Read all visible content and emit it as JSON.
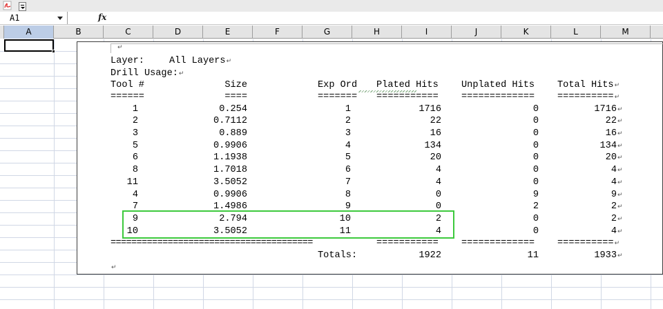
{
  "toolbar": {
    "pdf_icon": "pdf-icon",
    "dropdown_icon": "toolbar-dropdown-icon"
  },
  "formula_bar": {
    "name_box": "A1",
    "fx_label": "fx",
    "content": ""
  },
  "columns": [
    "A",
    "B",
    "C",
    "D",
    "E",
    "F",
    "G",
    "H",
    "I",
    "J",
    "K",
    "L",
    "M"
  ],
  "selected_column": "A",
  "report": {
    "layer_label": "Layer:",
    "layer_value": "All Layers",
    "drill_usage": "Drill Usage:",
    "headers": {
      "tool": "Tool #",
      "size": "Size",
      "exp_ord": "Exp Ord",
      "plated": "Plated Hits",
      "unplated": "Unplated Hits",
      "total": "Total Hits"
    },
    "header_rules": {
      "tool": "======",
      "size": "====",
      "exp_ord": "=======",
      "plated": "===========",
      "unplated": "=============",
      "total": "=========="
    },
    "rows": [
      {
        "tool": "1",
        "size": "0.254",
        "exp_ord": "1",
        "plated": "1716",
        "unplated": "0",
        "total": "1716"
      },
      {
        "tool": "2",
        "size": "0.7112",
        "exp_ord": "2",
        "plated": "22",
        "unplated": "0",
        "total": "22"
      },
      {
        "tool": "3",
        "size": "0.889",
        "exp_ord": "3",
        "plated": "16",
        "unplated": "0",
        "total": "16"
      },
      {
        "tool": "5",
        "size": "0.9906",
        "exp_ord": "4",
        "plated": "134",
        "unplated": "0",
        "total": "134"
      },
      {
        "tool": "6",
        "size": "1.1938",
        "exp_ord": "5",
        "plated": "20",
        "unplated": "0",
        "total": "20"
      },
      {
        "tool": "8",
        "size": "1.7018",
        "exp_ord": "6",
        "plated": "4",
        "unplated": "0",
        "total": "4"
      },
      {
        "tool": "11",
        "size": "3.5052",
        "exp_ord": "7",
        "plated": "4",
        "unplated": "0",
        "total": "4"
      },
      {
        "tool": "4",
        "size": "0.9906",
        "exp_ord": "8",
        "plated": "0",
        "unplated": "9",
        "total": "9"
      },
      {
        "tool": "7",
        "size": "1.4986",
        "exp_ord": "9",
        "plated": "0",
        "unplated": "2",
        "total": "2"
      },
      {
        "tool": "9",
        "size": "2.794",
        "exp_ord": "10",
        "plated": "2",
        "unplated": "0",
        "total": "2"
      },
      {
        "tool": "10",
        "size": "3.5052",
        "exp_ord": "11",
        "plated": "4",
        "unplated": "0",
        "total": "4"
      }
    ],
    "footer_rules": {
      "left": "=======================================",
      "plated": "===========",
      "unplated": "=============",
      "total": "=========="
    },
    "totals_label": "Totals:",
    "totals": {
      "plated": "1922",
      "unplated": "11",
      "total": "1933"
    },
    "paragraph_mark": "↵"
  },
  "highlight_color": "#3cc93c"
}
